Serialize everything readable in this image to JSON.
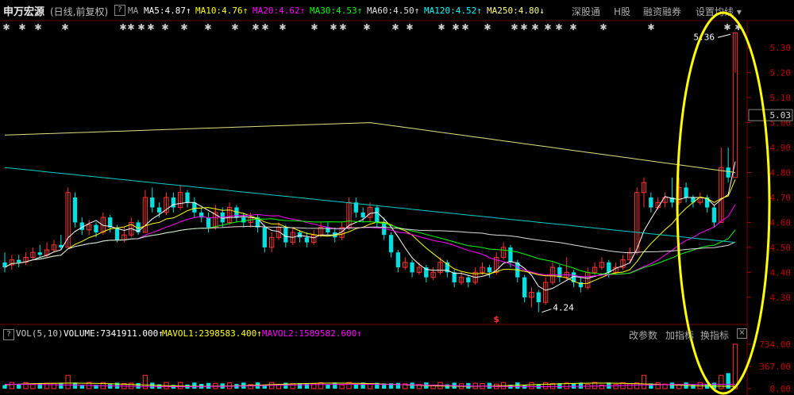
{
  "header": {
    "stock_name": "申万宏源",
    "sub_label": "(日线,前复权)",
    "help": "?",
    "ma_label": "MA",
    "ma_items": [
      {
        "label": "MA5:4.87",
        "arrow": "↑",
        "color": "#ffffff"
      },
      {
        "label": "MA10:4.76",
        "arrow": "↑",
        "color": "#ffff00"
      },
      {
        "label": "MA20:4.62",
        "arrow": "↑",
        "color": "#ff00ff"
      },
      {
        "label": "MA30:4.53",
        "arrow": "↑",
        "color": "#00ff00"
      },
      {
        "label": "MA60:4.50",
        "arrow": "↑",
        "color": "#e0e0e0"
      },
      {
        "label": "MA120:4.52",
        "arrow": "↑",
        "color": "#00ffff"
      },
      {
        "label": "MA250:4.80",
        "arrow": "↓",
        "color": "#ffff80"
      }
    ],
    "nav": [
      "深股通",
      "H股",
      "融资融券",
      "设置均线 ▾"
    ]
  },
  "price_axis": [
    "5.30",
    "5.20",
    "5.10",
    "5.00",
    "4.90",
    "4.80",
    "4.70",
    "4.60",
    "4.50",
    "4.40",
    "4.30"
  ],
  "current_price": "5.03",
  "annotations": {
    "high": "5.36",
    "low": "4.24",
    "marker": "$"
  },
  "volume_panel": {
    "label": "VOL(5,10)",
    "volume": "VOLUME:7341911.000",
    "mavol1": "MAVOL1:2398583.400",
    "mavol2": "MAVOL2:1589582.600",
    "arrow_volume": "↑",
    "arrow1": "↑",
    "arrow2": "↑",
    "help": "?",
    "nav": [
      "改参数",
      "加指标",
      "换指标"
    ],
    "close": "×",
    "axis": [
      "734.00",
      "367.00",
      "0.00"
    ]
  },
  "colors": {
    "up": "#ff3232",
    "down": "#00e0e0",
    "highlight": "#ffff00"
  },
  "chart_data": {
    "type": "candlestick",
    "y_range": [
      4.22,
      5.38
    ],
    "candles": [
      [
        4.44,
        4.42,
        4.48,
        4.4
      ],
      [
        4.43,
        4.45,
        4.47,
        4.41
      ],
      [
        4.45,
        4.44,
        4.47,
        4.42
      ],
      [
        4.44,
        4.46,
        4.48,
        4.43
      ],
      [
        4.46,
        4.48,
        4.5,
        4.45
      ],
      [
        4.48,
        4.47,
        4.51,
        4.46
      ],
      [
        4.47,
        4.49,
        4.52,
        4.46
      ],
      [
        4.49,
        4.51,
        4.53,
        4.48
      ],
      [
        4.51,
        4.5,
        4.55,
        4.49
      ],
      [
        4.5,
        4.72,
        4.74,
        4.5
      ],
      [
        4.7,
        4.6,
        4.72,
        4.58
      ],
      [
        4.6,
        4.57,
        4.62,
        4.55
      ],
      [
        4.57,
        4.59,
        4.61,
        4.55
      ],
      [
        4.59,
        4.56,
        4.6,
        4.54
      ],
      [
        4.56,
        4.62,
        4.64,
        4.55
      ],
      [
        4.62,
        4.58,
        4.63,
        4.56
      ],
      [
        4.58,
        4.53,
        4.59,
        4.52
      ],
      [
        4.53,
        4.55,
        4.58,
        4.52
      ],
      [
        4.55,
        4.6,
        4.62,
        4.54
      ],
      [
        4.6,
        4.56,
        4.61,
        4.55
      ],
      [
        4.56,
        4.7,
        4.73,
        4.56
      ],
      [
        4.7,
        4.66,
        4.74,
        4.64
      ],
      [
        4.66,
        4.64,
        4.68,
        4.62
      ],
      [
        4.64,
        4.7,
        4.72,
        4.63
      ],
      [
        4.7,
        4.66,
        4.72,
        4.64
      ],
      [
        4.66,
        4.72,
        4.75,
        4.65
      ],
      [
        4.72,
        4.68,
        4.73,
        4.66
      ],
      [
        4.68,
        4.64,
        4.7,
        4.62
      ],
      [
        4.64,
        4.62,
        4.66,
        4.6
      ],
      [
        4.62,
        4.58,
        4.64,
        4.56
      ],
      [
        4.58,
        4.64,
        4.67,
        4.57
      ],
      [
        4.64,
        4.6,
        4.66,
        4.58
      ],
      [
        4.6,
        4.66,
        4.68,
        4.59
      ],
      [
        4.66,
        4.62,
        4.67,
        4.6
      ],
      [
        4.62,
        4.6,
        4.64,
        4.58
      ],
      [
        4.6,
        4.62,
        4.64,
        4.58
      ],
      [
        4.62,
        4.58,
        4.63,
        4.56
      ],
      [
        4.58,
        4.5,
        4.59,
        4.48
      ],
      [
        4.5,
        4.54,
        4.56,
        4.48
      ],
      [
        4.54,
        4.58,
        4.6,
        4.53
      ],
      [
        4.58,
        4.52,
        4.59,
        4.5
      ],
      [
        4.52,
        4.56,
        4.58,
        4.51
      ],
      [
        4.56,
        4.54,
        4.57,
        4.52
      ],
      [
        4.54,
        4.52,
        4.56,
        4.5
      ],
      [
        4.52,
        4.55,
        4.57,
        4.51
      ],
      [
        4.55,
        4.58,
        4.6,
        4.54
      ],
      [
        4.58,
        4.56,
        4.6,
        4.55
      ],
      [
        4.56,
        4.54,
        4.58,
        4.52
      ],
      [
        4.54,
        4.58,
        4.6,
        4.53
      ],
      [
        4.58,
        4.68,
        4.7,
        4.57
      ],
      [
        4.68,
        4.64,
        4.7,
        4.62
      ],
      [
        4.64,
        4.62,
        4.66,
        4.6
      ],
      [
        4.62,
        4.66,
        4.68,
        4.6
      ],
      [
        4.66,
        4.6,
        4.67,
        4.58
      ],
      [
        4.6,
        4.55,
        4.62,
        4.53
      ],
      [
        4.55,
        4.48,
        4.56,
        4.46
      ],
      [
        4.48,
        4.42,
        4.49,
        4.4
      ],
      [
        4.42,
        4.44,
        4.46,
        4.41
      ],
      [
        4.44,
        4.4,
        4.45,
        4.38
      ],
      [
        4.4,
        4.42,
        4.44,
        4.39
      ],
      [
        4.42,
        4.38,
        4.43,
        4.36
      ],
      [
        4.38,
        4.4,
        4.42,
        4.37
      ],
      [
        4.4,
        4.44,
        4.46,
        4.39
      ],
      [
        4.44,
        4.4,
        4.45,
        4.38
      ],
      [
        4.4,
        4.36,
        4.41,
        4.34
      ],
      [
        4.36,
        4.38,
        4.4,
        4.35
      ],
      [
        4.38,
        4.36,
        4.39,
        4.34
      ],
      [
        4.36,
        4.4,
        4.42,
        4.35
      ],
      [
        4.4,
        4.42,
        4.44,
        4.39
      ],
      [
        4.42,
        4.4,
        4.43,
        4.38
      ],
      [
        4.4,
        4.46,
        4.48,
        4.39
      ],
      [
        4.46,
        4.5,
        4.52,
        4.45
      ],
      [
        4.5,
        4.44,
        4.51,
        4.42
      ],
      [
        4.44,
        4.38,
        4.45,
        4.36
      ],
      [
        4.38,
        4.3,
        4.39,
        4.28
      ],
      [
        4.3,
        4.32,
        4.34,
        4.26
      ],
      [
        4.32,
        4.28,
        4.33,
        4.24
      ],
      [
        4.28,
        4.36,
        4.38,
        4.27
      ],
      [
        4.36,
        4.42,
        4.44,
        4.35
      ],
      [
        4.42,
        4.38,
        4.43,
        4.36
      ],
      [
        4.38,
        4.4,
        4.46,
        4.37
      ],
      [
        4.4,
        4.36,
        4.41,
        4.34
      ],
      [
        4.36,
        4.34,
        4.38,
        4.32
      ],
      [
        4.34,
        4.4,
        4.42,
        4.33
      ],
      [
        4.4,
        4.42,
        4.44,
        4.39
      ],
      [
        4.42,
        4.44,
        4.46,
        4.41
      ],
      [
        4.44,
        4.4,
        4.45,
        4.38
      ],
      [
        4.4,
        4.42,
        4.44,
        4.39
      ],
      [
        4.42,
        4.45,
        4.47,
        4.41
      ],
      [
        4.45,
        4.48,
        4.5,
        4.44
      ],
      [
        4.48,
        4.72,
        4.74,
        4.47
      ],
      [
        4.72,
        4.76,
        4.78,
        4.66
      ],
      [
        4.7,
        4.66,
        4.72,
        4.64
      ],
      [
        4.66,
        4.68,
        4.7,
        4.65
      ],
      [
        4.68,
        4.7,
        4.72,
        4.66
      ],
      [
        4.7,
        4.68,
        4.78,
        4.66
      ],
      [
        4.68,
        4.74,
        4.78,
        4.67
      ],
      [
        4.74,
        4.7,
        4.76,
        4.68
      ],
      [
        4.7,
        4.68,
        4.71,
        4.66
      ],
      [
        4.68,
        4.7,
        4.72,
        4.67
      ],
      [
        4.7,
        4.66,
        4.71,
        4.64
      ],
      [
        4.66,
        4.6,
        4.67,
        4.58
      ],
      [
        4.6,
        4.82,
        4.9,
        4.6
      ],
      [
        4.82,
        4.78,
        4.9,
        4.76
      ],
      [
        4.78,
        5.36,
        5.36,
        5.2
      ]
    ]
  }
}
